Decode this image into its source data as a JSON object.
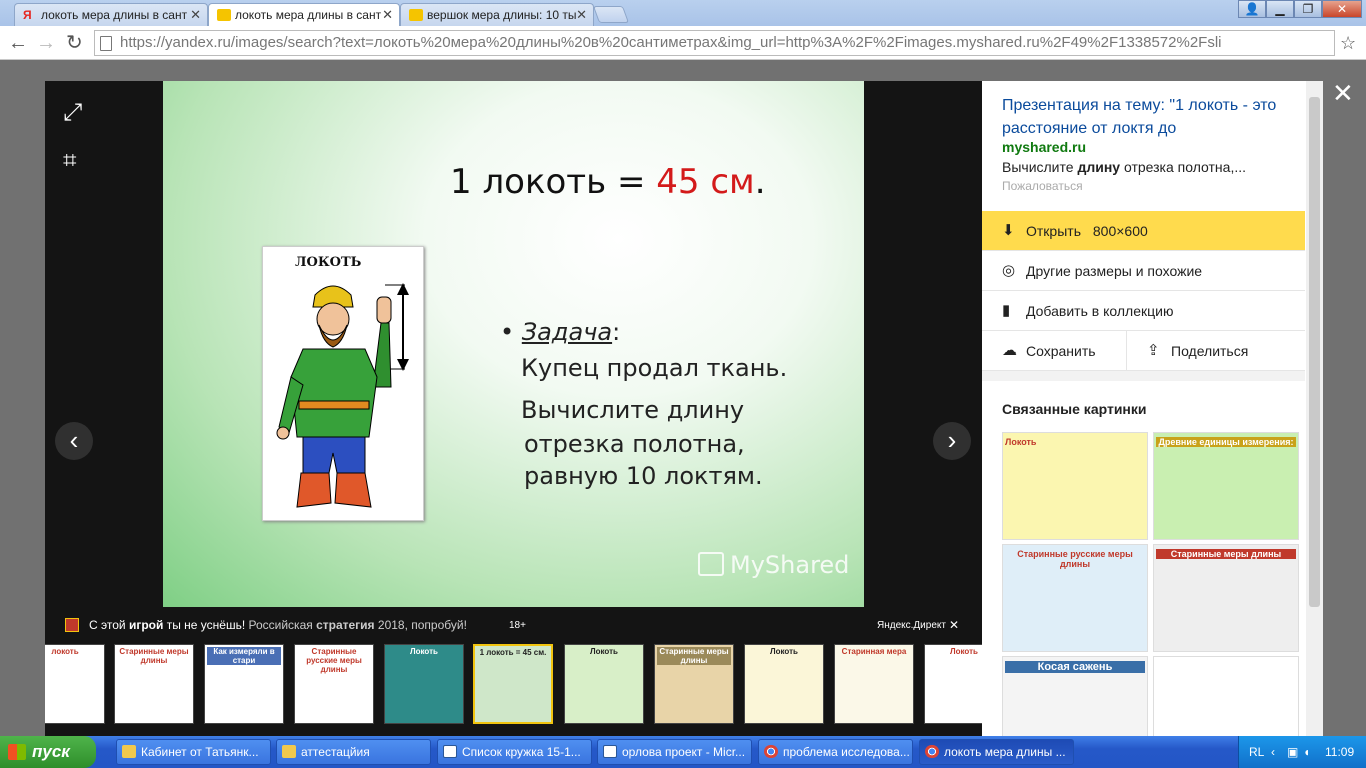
{
  "browser": {
    "tabs": [
      {
        "label": "локоть мера длины в сант",
        "favicon": "yandex-icon"
      },
      {
        "label": "локоть мера длины в сант",
        "favicon": "image-icon"
      },
      {
        "label": "вершок мера длины: 10 ты",
        "favicon": "image-icon"
      }
    ],
    "url": "https://yandex.ru/images/search?text=локоть%20мера%20длины%20в%20сантиметрах&img_url=http%3A%2F%2Fimages.myshared.ru%2F49%2F1338572%2Fsli"
  },
  "slide": {
    "title_prefix": "1 локоть = ",
    "title_value": "45 см",
    "title_suffix": ".",
    "card_label": "ЛОКОТЬ",
    "task_word": "Задача",
    "task_colon": ":",
    "line1": "Купец продал ткань.",
    "line2": "Вычислите длину",
    "line3": "отрезка полотна,",
    "line4": "равную 10 локтям.",
    "watermark": "MyShared"
  },
  "ad": {
    "p1": "С этой ",
    "b1": "игрой",
    "p2": " ты не уснёшь! ",
    "p3": "Российская ",
    "b2": "стратегия",
    "p4": " 2018, попробуй!",
    "age": "18+",
    "source": "Яндекс.Директ"
  },
  "thumbnails": [
    {
      "title": "локоть"
    },
    {
      "title": "Старинные меры длины"
    },
    {
      "title": "Как измеряли в стари"
    },
    {
      "title": "Старинные русские меры длины"
    },
    {
      "title": "Локоть"
    },
    {
      "title": "1 локоть = 45 см."
    },
    {
      "title": "Локоть"
    },
    {
      "title": "Старинные меры длины"
    },
    {
      "title": "Локоть"
    },
    {
      "title": "Старинная мера"
    },
    {
      "title": "Локоть"
    }
  ],
  "panel": {
    "title": "Презентация на тему: \"1 локоть - это расстояние от локтя до",
    "site": "myshared.ru",
    "desc_pre": "Вычислите ",
    "desc_bold": "длину",
    "desc_post": " отрезка полотна,...",
    "complain": "Пожаловаться",
    "open_label": "Открыть",
    "open_size": "800×600",
    "other_sizes": "Другие размеры и похожие",
    "add_collection": "Добавить в коллекцию",
    "save": "Сохранить",
    "share": "Поделиться",
    "related_heading": "Связанные картинки",
    "related": [
      {
        "title": "Локоть"
      },
      {
        "title": "Древние единицы измерения:"
      },
      {
        "title": "Старинные русские меры длины"
      },
      {
        "title": "Старинные меры длины"
      },
      {
        "title": "Косая сажень"
      },
      {
        "title": ""
      }
    ]
  },
  "taskbar": {
    "start": "пуск",
    "items": [
      {
        "label": "Кабинет от Татьянк...",
        "icon": "folder-icon"
      },
      {
        "label": "аттестацйия",
        "icon": "folder-icon"
      },
      {
        "label": "Список кружка 15-1...",
        "icon": "word-icon"
      },
      {
        "label": "орлова проект - Micr...",
        "icon": "word-icon"
      },
      {
        "label": "проблема исследова...",
        "icon": "chrome-icon"
      },
      {
        "label": "локоть мера длины ...",
        "icon": "chrome-icon"
      }
    ],
    "lang": "RL",
    "clock": "11:09"
  }
}
